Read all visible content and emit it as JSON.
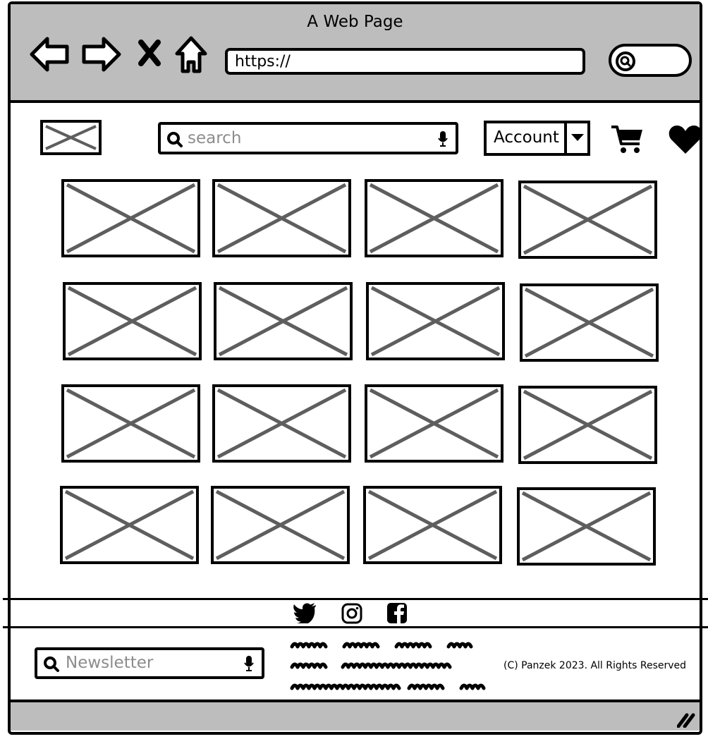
{
  "browser": {
    "window_title": "A Web Page",
    "url": "https://",
    "icons": [
      "back-arrow-icon",
      "forward-arrow-icon",
      "close-x-icon",
      "home-icon",
      "search-icon"
    ]
  },
  "header": {
    "logo": "image-placeholder",
    "search_placeholder": "search",
    "account_label": "Account",
    "icons": [
      "search-icon",
      "microphone-icon",
      "chevron-down-icon",
      "cart-icon",
      "heart-icon"
    ]
  },
  "product_grid": {
    "rows": 4,
    "columns": 4,
    "item": "image-placeholder"
  },
  "footer": {
    "social_icons": [
      "twitter-icon",
      "instagram-icon",
      "facebook-icon"
    ],
    "newsletter_placeholder": "Newsletter",
    "copyright": "(C) Panzek 2023. All Rights Reserved"
  },
  "colors": {
    "chrome": "#bdbdbd",
    "placeholder_cross": "#5e5e5e",
    "placeholder_text": "#8c8c8c"
  }
}
